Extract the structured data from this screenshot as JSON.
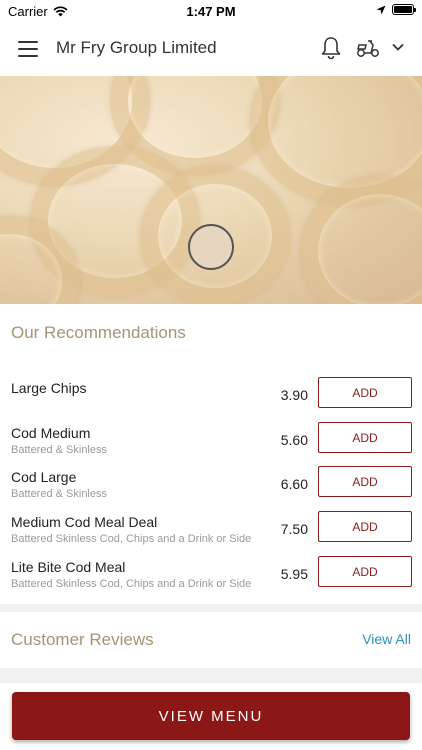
{
  "status_bar": {
    "carrier": "Carrier",
    "time": "1:47 PM",
    "battery_level": 1.0
  },
  "header": {
    "title": "Mr Fry Group Limited",
    "icons": [
      "menu-icon",
      "bell-icon",
      "scooter-icon",
      "chevron-down-icon"
    ]
  },
  "recommendations": {
    "title": "Our Recommendations",
    "add_label": "ADD",
    "items": [
      {
        "name": "Large Chips",
        "description": "",
        "price": "3.90"
      },
      {
        "name": "Cod Medium",
        "description": "Battered & Skinless",
        "price": "5.60"
      },
      {
        "name": "Cod Large",
        "description": "Battered & Skinless",
        "price": "6.60"
      },
      {
        "name": "Medium Cod Meal Deal",
        "description": "Battered Skinless Cod, Chips and a Drink or Side",
        "price": "7.50"
      },
      {
        "name": "Lite Bite Cod Meal",
        "description": "Battered Skinless Cod, Chips and a Drink or Side",
        "price": "5.95"
      }
    ]
  },
  "reviews": {
    "title": "Customer Reviews",
    "view_all_label": "View All"
  },
  "footer": {
    "view_menu_label": "VIEW MENU"
  },
  "colors": {
    "accent": "#8b1717",
    "section_title": "#a59474",
    "link": "#2a90bd"
  }
}
